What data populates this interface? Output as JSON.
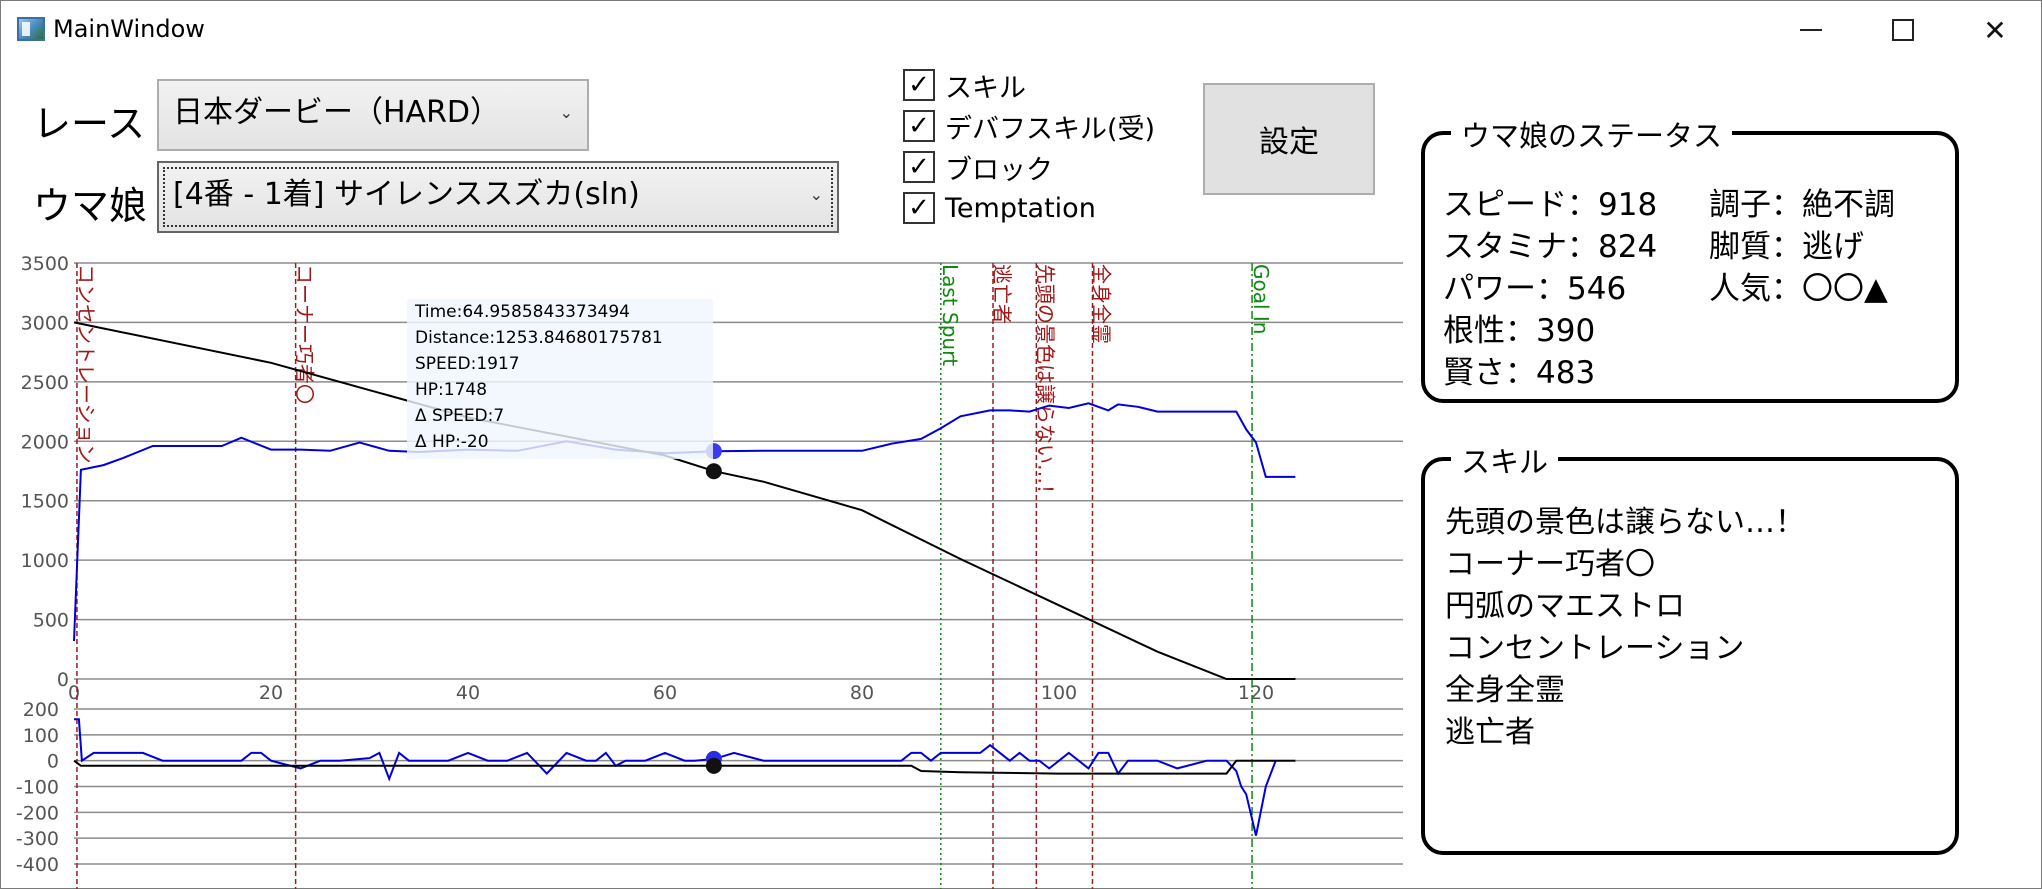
{
  "window": {
    "title": "MainWindow"
  },
  "controls": {
    "race_label": "レース",
    "race_value": "日本ダービー（HARD）",
    "horse_label": "ウマ娘",
    "horse_value": "[4番 - 1着] サイレンススズカ(sln)",
    "settings_label": "設定",
    "checkboxes": [
      {
        "label": "スキル",
        "checked": true
      },
      {
        "label": "デバフスキル(受)",
        "checked": true
      },
      {
        "label": "ブロック",
        "checked": true
      },
      {
        "label": "Temptation",
        "checked": true
      }
    ]
  },
  "status": {
    "title": "ウマ娘のステータス",
    "speed": "スピード：918",
    "stamina": "スタミナ：824",
    "power": "パワー：546",
    "guts": "根性：390",
    "wisdom": "賢さ：483",
    "condition": "調子：絶不調",
    "style": "脚質：逃げ",
    "popularity": "人気：〇〇▲"
  },
  "skills": {
    "title": "スキル",
    "items": [
      "先頭の景色は譲らない…！",
      "コーナー巧者〇",
      "円弧のマエストロ",
      "コンセントレーション",
      "全身全霊",
      "逃亡者"
    ]
  },
  "tooltip": {
    "time": "Time:64.9585843373494",
    "distance": "Distance:1253.84680175781",
    "speed": "SPEED:1917",
    "hp": "HP:1748",
    "dspeed": "Δ SPEED:7",
    "dhp": "Δ HP:-20"
  },
  "chart_data": [
    {
      "type": "line",
      "xlim": [
        0,
        124
      ],
      "ylim": [
        0,
        3500
      ],
      "xticks": [
        0,
        20,
        40,
        60,
        80,
        100,
        120
      ],
      "yticks": [
        0,
        500,
        1000,
        1500,
        2000,
        2500,
        3000,
        3500
      ],
      "series": [
        {
          "name": "SPEED",
          "color": "#0000dd",
          "x": [
            0,
            0.7,
            3,
            5,
            8,
            15,
            17,
            20,
            23,
            26,
            29,
            32,
            35,
            40,
            45,
            50,
            55,
            60,
            65,
            70,
            75,
            80,
            83,
            86,
            88,
            90,
            93,
            95,
            97,
            99,
            101,
            103,
            105,
            106,
            108,
            110,
            113,
            116,
            118,
            119,
            120,
            121,
            124
          ],
          "y": [
            320,
            1760,
            1800,
            1860,
            1960,
            1960,
            2030,
            1930,
            1930,
            1920,
            1990,
            1920,
            1910,
            1930,
            1920,
            2000,
            1930,
            1900,
            1917,
            1920,
            1920,
            1920,
            1980,
            2020,
            2110,
            2210,
            2260,
            2260,
            2250,
            2300,
            2280,
            2320,
            2260,
            2310,
            2290,
            2250,
            2250,
            2250,
            2250,
            2100,
            1990,
            1700,
            1700
          ]
        },
        {
          "name": "HP",
          "color": "#000000",
          "x": [
            0,
            20,
            40,
            60,
            65,
            70,
            80,
            90,
            100,
            110,
            117,
            118,
            124
          ],
          "y": [
            3000,
            2660,
            2200,
            1880,
            1748,
            1660,
            1420,
            1010,
            620,
            230,
            0,
            0,
            0
          ]
        }
      ],
      "markers": [
        {
          "x": 0.3,
          "label": "コンセントレーション",
          "color": "#a01818",
          "style": "dash"
        },
        {
          "x": 22.5,
          "label": "コーナー巧者〇",
          "color": "#a01818",
          "style": "dash"
        },
        {
          "x": 88,
          "label": "Last Spurt",
          "color": "#118811",
          "style": "dot"
        },
        {
          "x": 93.3,
          "label": "逃亡者",
          "color": "#a01818",
          "style": "dash"
        },
        {
          "x": 97.7,
          "label": "先頭の景色は譲らない…！",
          "color": "#a01818",
          "style": "dash"
        },
        {
          "x": 103.4,
          "label": "全身全霊",
          "color": "#a01818",
          "style": "dash"
        },
        {
          "x": 119.6,
          "label": "Goal In",
          "color": "#118811",
          "style": "dashdot"
        }
      ],
      "cursor": {
        "x": 64.96,
        "speed": 1917,
        "hp": 1748
      }
    },
    {
      "type": "line",
      "xlim": [
        0,
        124
      ],
      "ylim": [
        -400,
        200
      ],
      "yticks": [
        200,
        100,
        0,
        -100,
        -200,
        -300,
        -400
      ],
      "series": [
        {
          "name": "Δ SPEED",
          "color": "#0000dd",
          "x": [
            0,
            0.5,
            0.8,
            2,
            3,
            7,
            9,
            12,
            15,
            17,
            18,
            19,
            20,
            23,
            25,
            27,
            30,
            31,
            32,
            33,
            34,
            38,
            40,
            42,
            44,
            46,
            48,
            50,
            52,
            53,
            54,
            55,
            56,
            58,
            60,
            62,
            63,
            65,
            67,
            70,
            72,
            74,
            76,
            78,
            80,
            82,
            84,
            85,
            86,
            87,
            88,
            90,
            92,
            93,
            95,
            96,
            97,
            98,
            99,
            100,
            101,
            102,
            103,
            104,
            105,
            106,
            107,
            108,
            110,
            112,
            115,
            117,
            118,
            118.5,
            119,
            120,
            121,
            122
          ],
          "y": [
            160,
            160,
            0,
            30,
            30,
            30,
            0,
            0,
            0,
            0,
            30,
            30,
            0,
            -30,
            0,
            0,
            10,
            30,
            -70,
            30,
            0,
            0,
            30,
            0,
            0,
            30,
            -50,
            30,
            0,
            0,
            30,
            -20,
            0,
            0,
            30,
            0,
            0,
            7,
            30,
            0,
            0,
            0,
            0,
            0,
            0,
            0,
            0,
            30,
            30,
            0,
            30,
            30,
            30,
            60,
            0,
            30,
            0,
            0,
            -30,
            0,
            30,
            0,
            -30,
            30,
            30,
            -50,
            0,
            0,
            0,
            -30,
            0,
            0,
            -40,
            -100,
            -130,
            -290,
            -100,
            0
          ]
        },
        {
          "name": "Δ HP",
          "color": "#000000",
          "x": [
            0,
            0.7,
            2,
            5,
            20,
            40,
            60,
            65,
            70,
            85,
            86,
            90,
            100,
            105,
            110,
            117,
            118,
            119,
            124
          ],
          "y": [
            0,
            -20,
            -20,
            -20,
            -20,
            -20,
            -20,
            -20,
            -20,
            -20,
            -40,
            -45,
            -50,
            -50,
            -50,
            -50,
            0,
            0,
            0
          ]
        }
      ],
      "cursor": {
        "x": 64.96,
        "dspeed": 7,
        "dhp": -20
      }
    }
  ]
}
